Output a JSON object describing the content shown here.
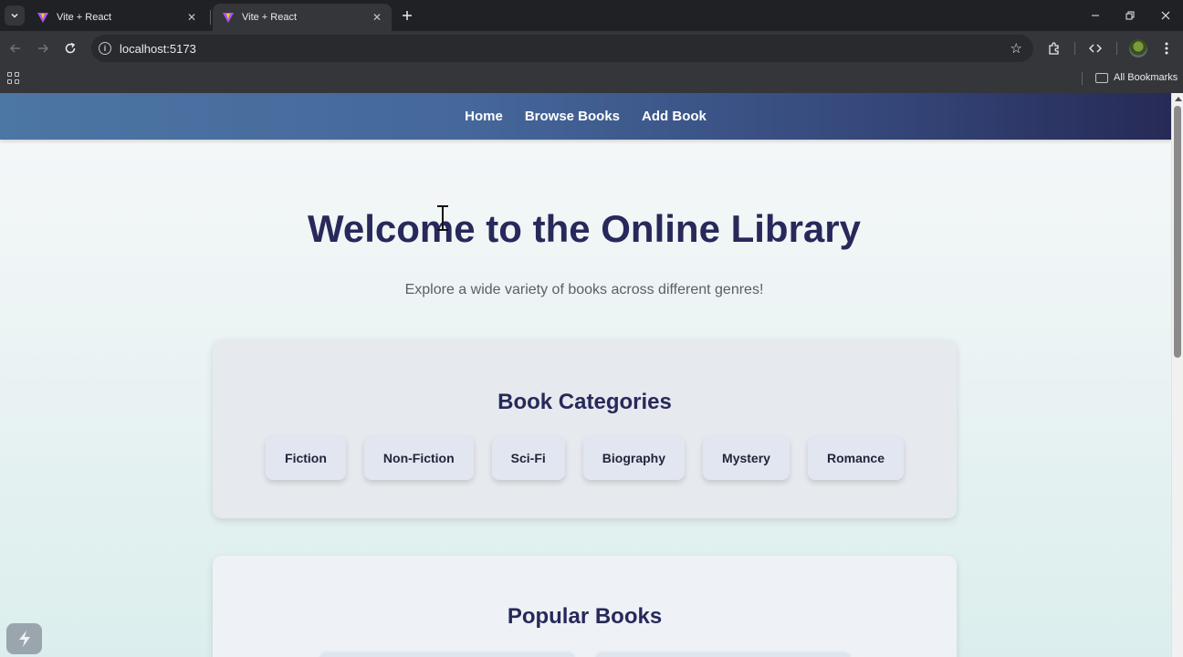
{
  "browser": {
    "tabs": [
      {
        "title": "Vite + React",
        "active": false
      },
      {
        "title": "Vite + React",
        "active": true
      }
    ],
    "address": "localhost:5173",
    "bookmarks_bar": {
      "all_bookmarks_label": "All Bookmarks"
    }
  },
  "site": {
    "nav": [
      "Home",
      "Browse Books",
      "Add Book"
    ],
    "hero": {
      "title": "Welcome to the Online Library",
      "subtitle": "Explore a wide variety of books across different genres!"
    },
    "categories": {
      "title": "Book Categories",
      "items": [
        "Fiction",
        "Non-Fiction",
        "Sci-Fi",
        "Biography",
        "Mystery",
        "Romance"
      ]
    },
    "popular": {
      "title": "Popular Books"
    }
  },
  "colors": {
    "nav_gradient_start": "#4c76a4",
    "nav_gradient_end": "#262a56",
    "heading": "#27295a"
  }
}
